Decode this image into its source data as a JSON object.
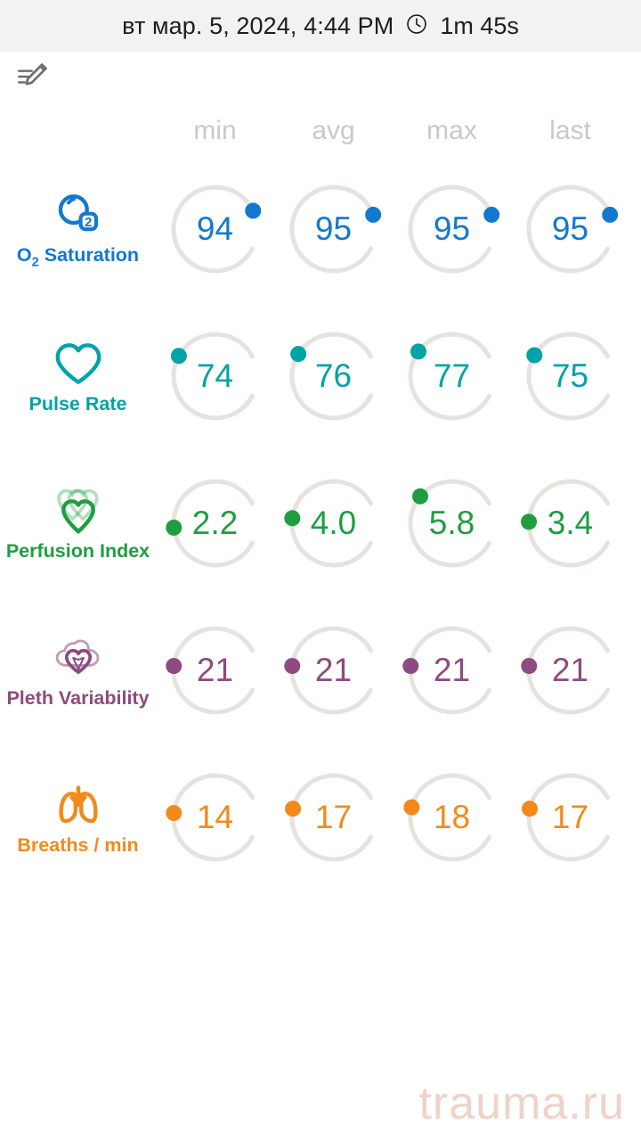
{
  "header": {
    "datetime": "вт мар. 5, 2024, 4:44 PM",
    "clock_icon": "clock-icon",
    "duration": "1m 45s",
    "bar_color": "#f2f2f2"
  },
  "toolbar": {
    "edit_icon": "edit-note-icon"
  },
  "columns": [
    "min",
    "avg",
    "max",
    "last"
  ],
  "watermark": "trauma.ru",
  "chart_data": {
    "type": "table",
    "title": "Vital signs summary gauges",
    "categories": [
      "min",
      "avg",
      "max",
      "last"
    ],
    "series": [
      {
        "name": "O₂ Saturation",
        "icon": "o2-saturation-icon",
        "color": "#1279cf",
        "values": [
          94,
          95,
          95,
          95
        ],
        "display": [
          "94",
          "95",
          "95",
          "95"
        ],
        "dot_angles": [
          64,
          70,
          70,
          70
        ],
        "gauge_min": 0,
        "gauge_max": 100
      },
      {
        "name": "Pulse Rate",
        "icon": "heart-outline-icon",
        "color": "#00a3a6",
        "values": [
          74,
          76,
          77,
          75
        ],
        "display": [
          "74",
          "76",
          "77",
          "75"
        ],
        "dot_angles": [
          -61,
          -58,
          -54,
          -60
        ],
        "gauge_min": 0,
        "gauge_max": 220
      },
      {
        "name": "Perfusion Index",
        "icon": "triple-heart-icon",
        "color": "#1e9e41",
        "values": [
          2.2,
          4.0,
          5.8,
          3.4
        ],
        "display": [
          "2.2",
          "4.0",
          "5.8",
          "3.4"
        ],
        "dot_angles": [
          -96,
          -83,
          -50,
          -88
        ],
        "gauge_min": 0,
        "gauge_max": 20
      },
      {
        "name": "Pleth Variability",
        "icon": "cloud-heart-icon",
        "color": "#8d4b7f",
        "values": [
          21,
          21,
          21,
          21
        ],
        "display": [
          "21",
          "21",
          "21",
          "21"
        ],
        "dot_angles": [
          -84,
          -84,
          -84,
          -84
        ],
        "gauge_min": 0,
        "gauge_max": 100
      },
      {
        "name": "Breaths / min",
        "icon": "lungs-icon",
        "color": "#f28a1b",
        "values": [
          14,
          17,
          18,
          17
        ],
        "display": [
          "14",
          "17",
          "18",
          "17"
        ],
        "dot_angles": [
          -84,
          -78,
          -76,
          -78
        ],
        "gauge_min": 0,
        "gauge_max": 60
      }
    ],
    "track_color": "#e6e3de",
    "legend": "none",
    "grid": false
  }
}
